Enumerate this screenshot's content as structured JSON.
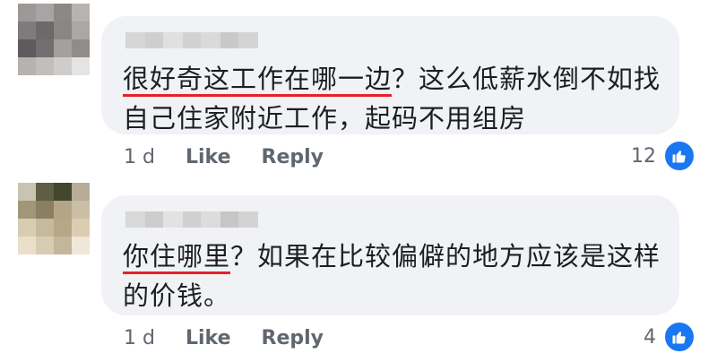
{
  "comments": [
    {
      "text_underlined": "很好奇这工作在哪一边",
      "text_rest": "？这么低薪水倒不如找自己住家附近工作，起码不用组房",
      "time": "1 d",
      "like_label": "Like",
      "reply_label": "Reply",
      "reaction_count": "12",
      "reaction_icon": "thumbs-up-icon",
      "avatar_colors": [
        "#9c9896",
        "#a6a4a5",
        "#8c8886",
        "#b7b3b1",
        "#7d7b7b",
        "#6c6a69",
        "#8a8684",
        "#aaa7a5",
        "#5d5b5d",
        "#716f70",
        "#a3a09e",
        "#8f8c8a",
        "#b5b2b0",
        "#c1bebc",
        "#cfcccc",
        "#e6e4e3"
      ],
      "name_colors": [
        "#d6d6d6",
        "#cfcfcf",
        "#e0e0e0",
        "#d2d2d2",
        "#dadada",
        "#c9c9c9",
        "#d4d4d4"
      ]
    },
    {
      "text_underlined": "你住哪里",
      "text_rest": "？如果在比较偏僻的地方应该是这样的价钱。",
      "time": "1 d",
      "like_label": "Like",
      "reply_label": "Reply",
      "reaction_count": "4",
      "reaction_icon": "thumbs-up-icon",
      "avatar_colors": [
        "#c9c3b3",
        "#5d5e43",
        "#43452f",
        "#b5ad98",
        "#a29679",
        "#8a7f60",
        "#b3a586",
        "#cabea4",
        "#d8ccb1",
        "#c7b99c",
        "#b7a688",
        "#dccdb1",
        "#e9dfcb",
        "#d8ccb4",
        "#c4b69a",
        "#efe7d7"
      ],
      "name_colors": [
        "#d8d8d8",
        "#cccccc",
        "#e2e2e2",
        "#d0d0d0",
        "#dcdcdc",
        "#c6c6c6",
        "#d3d3d3"
      ]
    }
  ],
  "accent_colors": {
    "underline": "#e8202a",
    "like_badge": "#1a77f2"
  }
}
